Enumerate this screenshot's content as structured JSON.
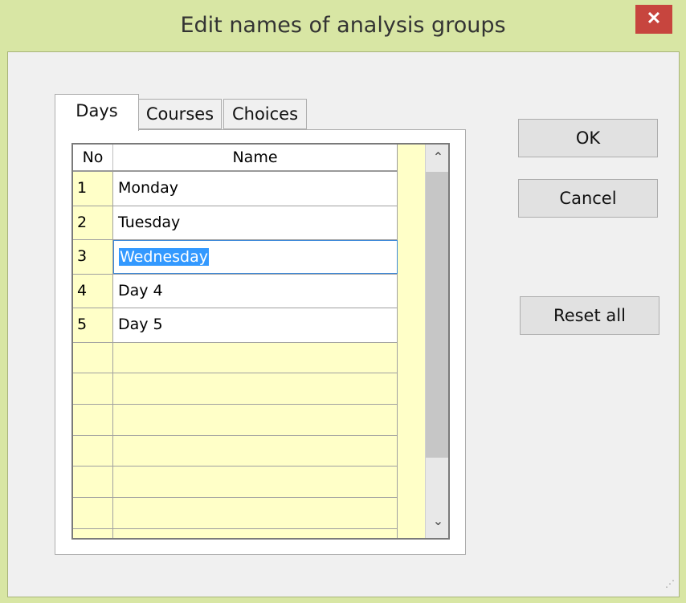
{
  "window": {
    "title": "Edit names of analysis groups",
    "close_glyph": "✕"
  },
  "tabs": [
    {
      "label": "Days",
      "active": true
    },
    {
      "label": "Courses",
      "active": false
    },
    {
      "label": "Choices",
      "active": false
    }
  ],
  "grid": {
    "columns": [
      "No",
      "Name"
    ],
    "rows": [
      {
        "no": "1",
        "name": "Monday"
      },
      {
        "no": "2",
        "name": "Tuesday"
      },
      {
        "no": "3",
        "name": "Wednesday"
      },
      {
        "no": "4",
        "name": "Day 4"
      },
      {
        "no": "5",
        "name": "Day 5"
      }
    ],
    "editing_row": 3,
    "scroll_up_glyph": "⌃",
    "scroll_down_glyph": "⌄"
  },
  "buttons": {
    "ok": "OK",
    "cancel": "Cancel",
    "reset": "Reset all"
  },
  "colors": {
    "frame": "#d8e6a4",
    "grid_background": "#ffffc8",
    "selection": "#3399ff",
    "close": "#c7453e"
  }
}
